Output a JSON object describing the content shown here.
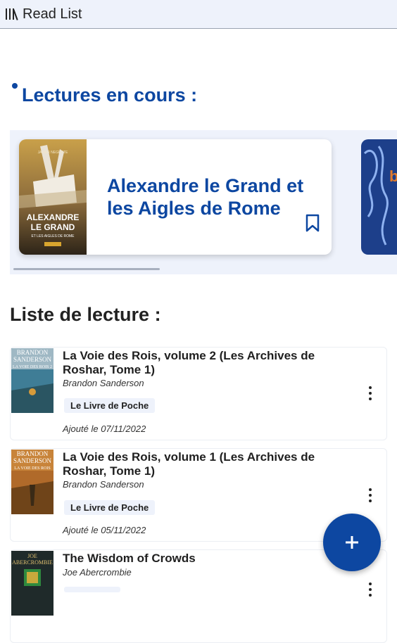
{
  "app": {
    "title": "Read List",
    "icon": "library-icon"
  },
  "current": {
    "heading": "Lectures en cours :",
    "books": [
      {
        "title": "Alexandre le Grand et les Aigles de Rome",
        "cover_text": [
          "ALEXANDRE",
          "LE GRAND",
          "ET LES AIGLES DE ROME"
        ],
        "cover_author": "JAVIER NEGRETE"
      }
    ],
    "next_peek": "b"
  },
  "list": {
    "heading": "Liste de lecture :",
    "items": [
      {
        "title": "La Voie des Rois, volume 2 (Les Archives de Roshar, Tome 1)",
        "author": "Brandon Sanderson",
        "publisher": "Le Livre de Poche",
        "added": "Ajouté le 07/11/2022",
        "cover_author": [
          "BRANDON",
          "SANDERSON"
        ],
        "cover_title": "LA VOIE DES ROIS 2"
      },
      {
        "title": "La Voie des Rois, volume 1 (Les Archives de Roshar, Tome 1)",
        "author": "Brandon Sanderson",
        "publisher": "Le Livre de Poche",
        "added": "Ajouté le 05/11/2022",
        "cover_author": [
          "BRANDON",
          "SANDERSON"
        ],
        "cover_title": "LA VOIE DES ROIS"
      },
      {
        "title": "The Wisdom of Crowds",
        "author": "Joe Abercrombie",
        "cover_author": [
          "JOE",
          "ABERCROMBIE"
        ]
      }
    ]
  },
  "colors": {
    "accent": "#0d47a1",
    "topbar": "#eef2fb"
  },
  "fab": {
    "icon": "plus-icon"
  }
}
